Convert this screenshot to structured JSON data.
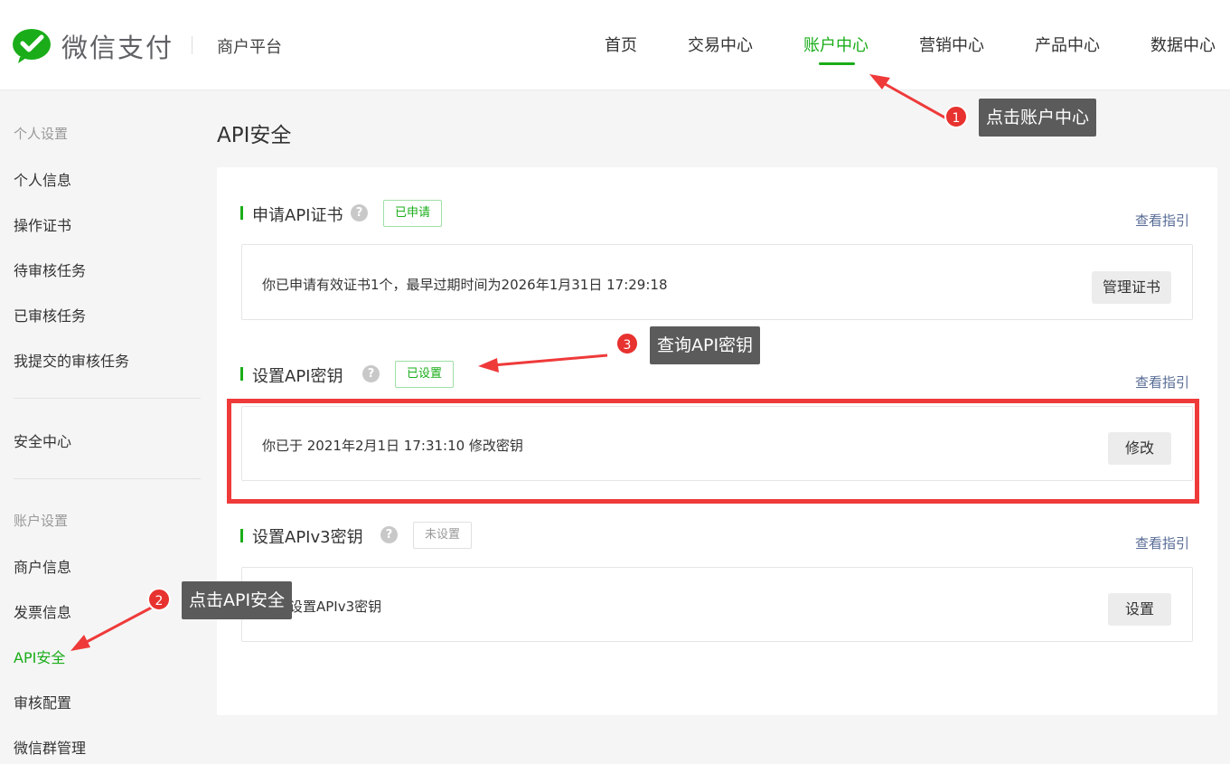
{
  "header": {
    "logo_text": "微信支付",
    "platform": "商户平台",
    "nav": [
      "首页",
      "交易中心",
      "账户中心",
      "营销中心",
      "产品中心",
      "数据中心"
    ],
    "active_nav": "账户中心"
  },
  "sidebar": {
    "personal_title": "个人设置",
    "personal_items": [
      "个人信息",
      "操作证书",
      "待审核任务",
      "已审核任务",
      "我提交的审核任务"
    ],
    "security": "安全中心",
    "account_title": "账户设置",
    "account_items": [
      "商户信息",
      "发票信息",
      "API安全",
      "审核配置",
      "微信群管理"
    ],
    "active_item": "API安全"
  },
  "main": {
    "page_title": "API安全",
    "sections": [
      {
        "title": "申请API证书",
        "tag": "已申请",
        "guide": "查看指引",
        "text": "你已申请有效证书1个，最早过期时间为2026年1月31日 17:29:18",
        "button": "管理证书"
      },
      {
        "title": "设置API密钥",
        "tag": "已设置",
        "guide": "查看指引",
        "text": "你已于 2021年2月1日 17:31:10 修改密钥",
        "button": "修改"
      },
      {
        "title": "设置APIv3密钥",
        "tag": "未设置",
        "guide": "查看指引",
        "text": "尚未设置APIv3密钥",
        "button": "设置"
      }
    ]
  },
  "annotations": [
    {
      "number": "1",
      "label": "点击账户中心"
    },
    {
      "number": "2",
      "label": "点击API安全"
    },
    {
      "number": "3",
      "label": "查询API密钥"
    }
  ],
  "colors": {
    "brand_green": "#1aad19",
    "link_blue": "#576b95",
    "annotation_red": "#e7322f",
    "tooltip_gray": "#5b5b5b"
  },
  "icons": {
    "logo": "wechat-pay-logo-icon",
    "help": "question-mark-icon",
    "arrow": "red-arrow-icon"
  }
}
